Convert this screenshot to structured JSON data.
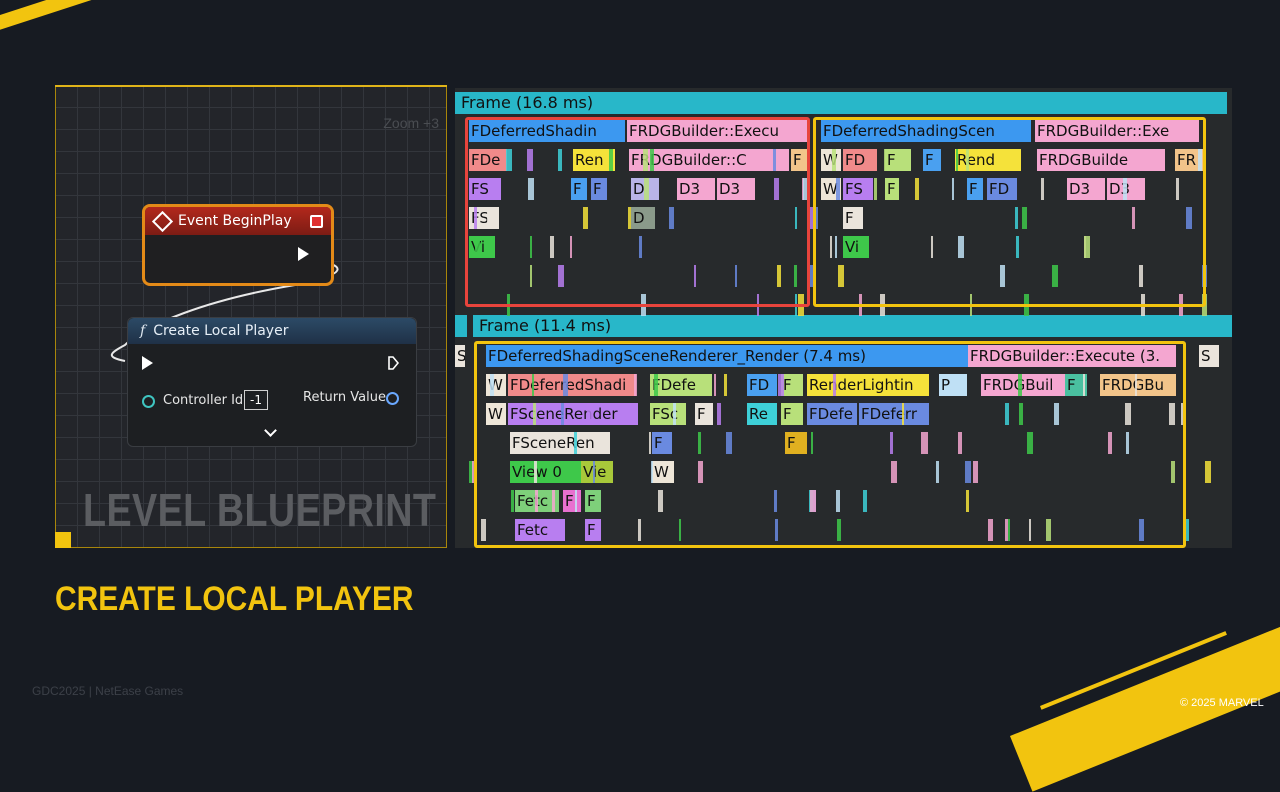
{
  "blueprint": {
    "zoom_label": "Zoom +3",
    "watermark": "LEVEL BLUEPRINT",
    "event_node": {
      "title": "Event BeginPlay"
    },
    "create_node": {
      "func_glyph": "f",
      "title": "Create Local Player",
      "controller_label": "Controller Id",
      "controller_value": "-1",
      "return_label": "Return Value"
    }
  },
  "profiler": {
    "frame1_label": "Frame (16.8 ms)",
    "frame2_label": "Frame (11.4 ms)",
    "highlight_colors": {
      "red": "#e8443c",
      "yellow": "#f2c40f"
    },
    "bars": [
      {
        "t": "FDeferredShadin",
        "c": "#3c98f0"
      },
      {
        "t": "FRDGBuilder::Execu",
        "c": "#f4a6d0"
      },
      {
        "t": "FDeferredShadingScen",
        "c": "#3c98f0"
      },
      {
        "t": "FRDGBuilder::Exe",
        "c": "#f4a6d0"
      },
      {
        "t": "FDe",
        "c": "#f08a8a"
      },
      {
        "t": "Ren",
        "c": "#f5e23a"
      },
      {
        "t": "FRDGBuilder::C",
        "c": "#f4a6d0"
      },
      {
        "t": "F",
        "c": "#f2c48a"
      },
      {
        "t": "W",
        "c": "#eee6d8"
      },
      {
        "t": "FD",
        "c": "#f08a8a"
      },
      {
        "t": "F",
        "c": "#b8e07a"
      },
      {
        "t": "F",
        "c": "#4aa0f0"
      },
      {
        "t": "Rend",
        "c": "#f5e23a"
      },
      {
        "t": "FRDGBuilde",
        "c": "#f4a6d0"
      },
      {
        "t": "FR",
        "c": "#f2c48a"
      },
      {
        "t": "FS",
        "c": "#b87ef0"
      },
      {
        "t": "F",
        "c": "#4aa0f0"
      },
      {
        "t": "F",
        "c": "#6a8ae0"
      },
      {
        "t": "D",
        "c": "#b9b4e8"
      },
      {
        "t": "D3",
        "c": "#f4a6d0"
      },
      {
        "t": "D3",
        "c": "#f4a6d0"
      },
      {
        "t": "W",
        "c": "#eee6d8"
      },
      {
        "t": "FS",
        "c": "#b87ef0"
      },
      {
        "t": "F",
        "c": "#b8e07a"
      },
      {
        "t": "F",
        "c": "#4aa0f0"
      },
      {
        "t": "FD",
        "c": "#6a8ae0"
      },
      {
        "t": "D3",
        "c": "#f4a6d0"
      },
      {
        "t": "D3",
        "c": "#f4a6d0"
      },
      {
        "t": "FS",
        "c": "#eae4dc"
      },
      {
        "t": "D",
        "c": "#8a9a8a"
      },
      {
        "t": "F",
        "c": "#eae4dc"
      },
      {
        "t": "Vi",
        "c": "#3ec84a"
      },
      {
        "t": "Vi",
        "c": "#3ec84a"
      },
      {
        "t": "S",
        "c": "#eae4dc"
      },
      {
        "t": "FDeferredShadingSceneRenderer_Render (7.4 ms)",
        "c": "#3c98f0"
      },
      {
        "t": "FRDGBuilder::Execute (3.",
        "c": "#f4a6d0"
      },
      {
        "t": "S",
        "c": "#eae4dc"
      },
      {
        "t": "W",
        "c": "#eee6d8"
      },
      {
        "t": "FDeferredShadi",
        "c": "#f08a8a"
      },
      {
        "t": "FDefe",
        "c": "#b8e07a"
      },
      {
        "t": "FD",
        "c": "#4aa0f0"
      },
      {
        "t": "F",
        "c": "#b8e07a"
      },
      {
        "t": "RenderLightin",
        "c": "#f5e23a"
      },
      {
        "t": "P",
        "c": "#bfe0f5"
      },
      {
        "t": "FRDGBuil",
        "c": "#f4a6d0"
      },
      {
        "t": "F",
        "c": "#4ac0a0"
      },
      {
        "t": "FRDGBu",
        "c": "#f2c48a"
      },
      {
        "t": "W",
        "c": "#eee6d8"
      },
      {
        "t": "FSceneRender",
        "c": "#b87ef0"
      },
      {
        "t": "FSc",
        "c": "#b8e07a"
      },
      {
        "t": "F",
        "c": "#eae4dc"
      },
      {
        "t": "Re",
        "c": "#3ed0d8"
      },
      {
        "t": "F",
        "c": "#b8e07a"
      },
      {
        "t": "FDefe",
        "c": "#6a8ae0"
      },
      {
        "t": "FDeferr",
        "c": "#6a8ae0"
      },
      {
        "t": "FSceneRen",
        "c": "#eae4dc"
      },
      {
        "t": "F",
        "c": "#6a8ae0"
      },
      {
        "t": "F",
        "c": "#e0b020"
      },
      {
        "t": "View 0",
        "c": "#3ec84a"
      },
      {
        "t": "Vie",
        "c": "#a8c83a"
      },
      {
        "t": "W",
        "c": "#eee6d8"
      },
      {
        "t": "Fetc",
        "c": "#7ed07a"
      },
      {
        "t": "F",
        "c": "#e870d0"
      },
      {
        "t": "F",
        "c": "#7ed07a"
      },
      {
        "t": "Fetc",
        "c": "#b87ef0"
      },
      {
        "t": "F",
        "c": "#b87ef0"
      }
    ]
  },
  "slide": {
    "title": "CREATE LOCAL PLAYER",
    "footer_left": "GDC2025 | NetEase Games",
    "footer_right": "© 2025 MARVEL"
  },
  "colors": {
    "accent": "#f2c40f",
    "background": "#171b22"
  }
}
